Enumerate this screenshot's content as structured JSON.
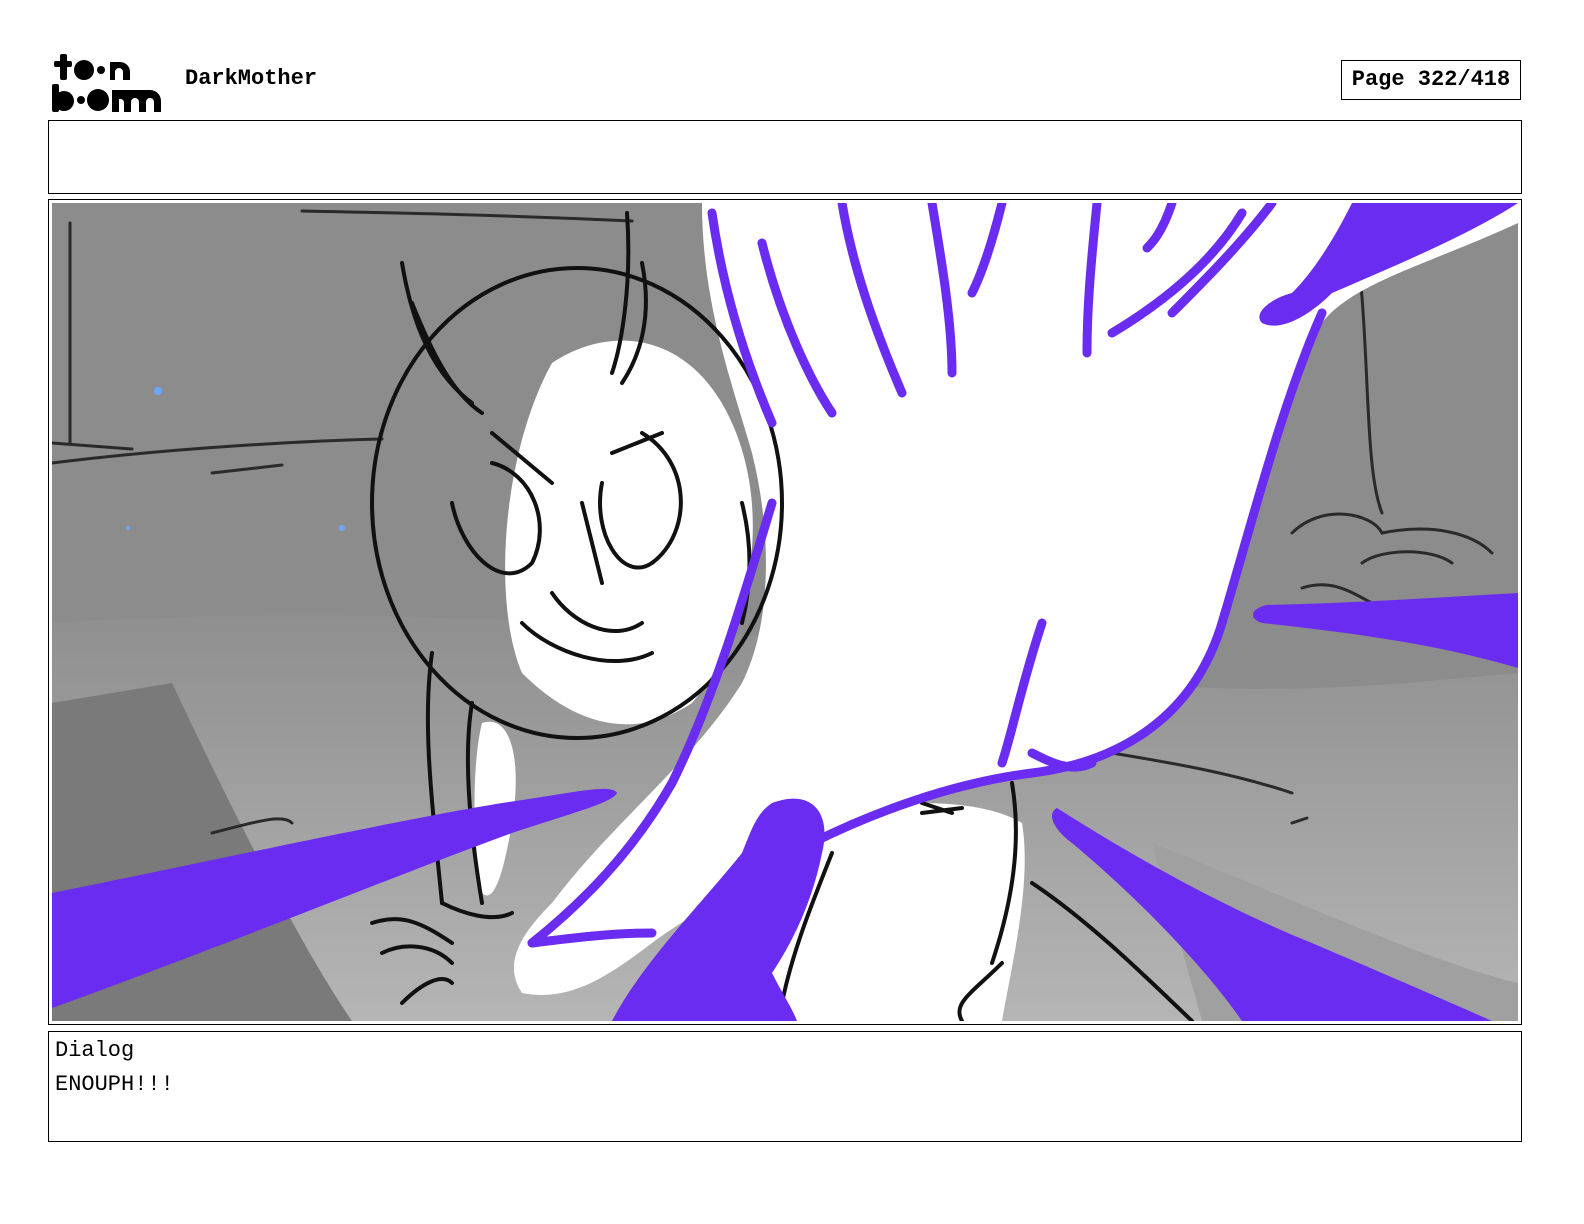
{
  "header": {
    "logo_text": "toon boom",
    "project_title": "DarkMother",
    "page_label": "Page 322/418"
  },
  "notes": {
    "text": ""
  },
  "panel": {
    "palette": {
      "background_gray": "#8a8a8a",
      "floor_gray": "#a9a9a9",
      "highlight_white": "#ffffff",
      "line_black": "#111111",
      "effect_purple": "#6a2cf0",
      "spark_blue": "#6aa8ff"
    }
  },
  "dialog": {
    "label": "Dialog",
    "text": "ENOUPH!!!"
  }
}
